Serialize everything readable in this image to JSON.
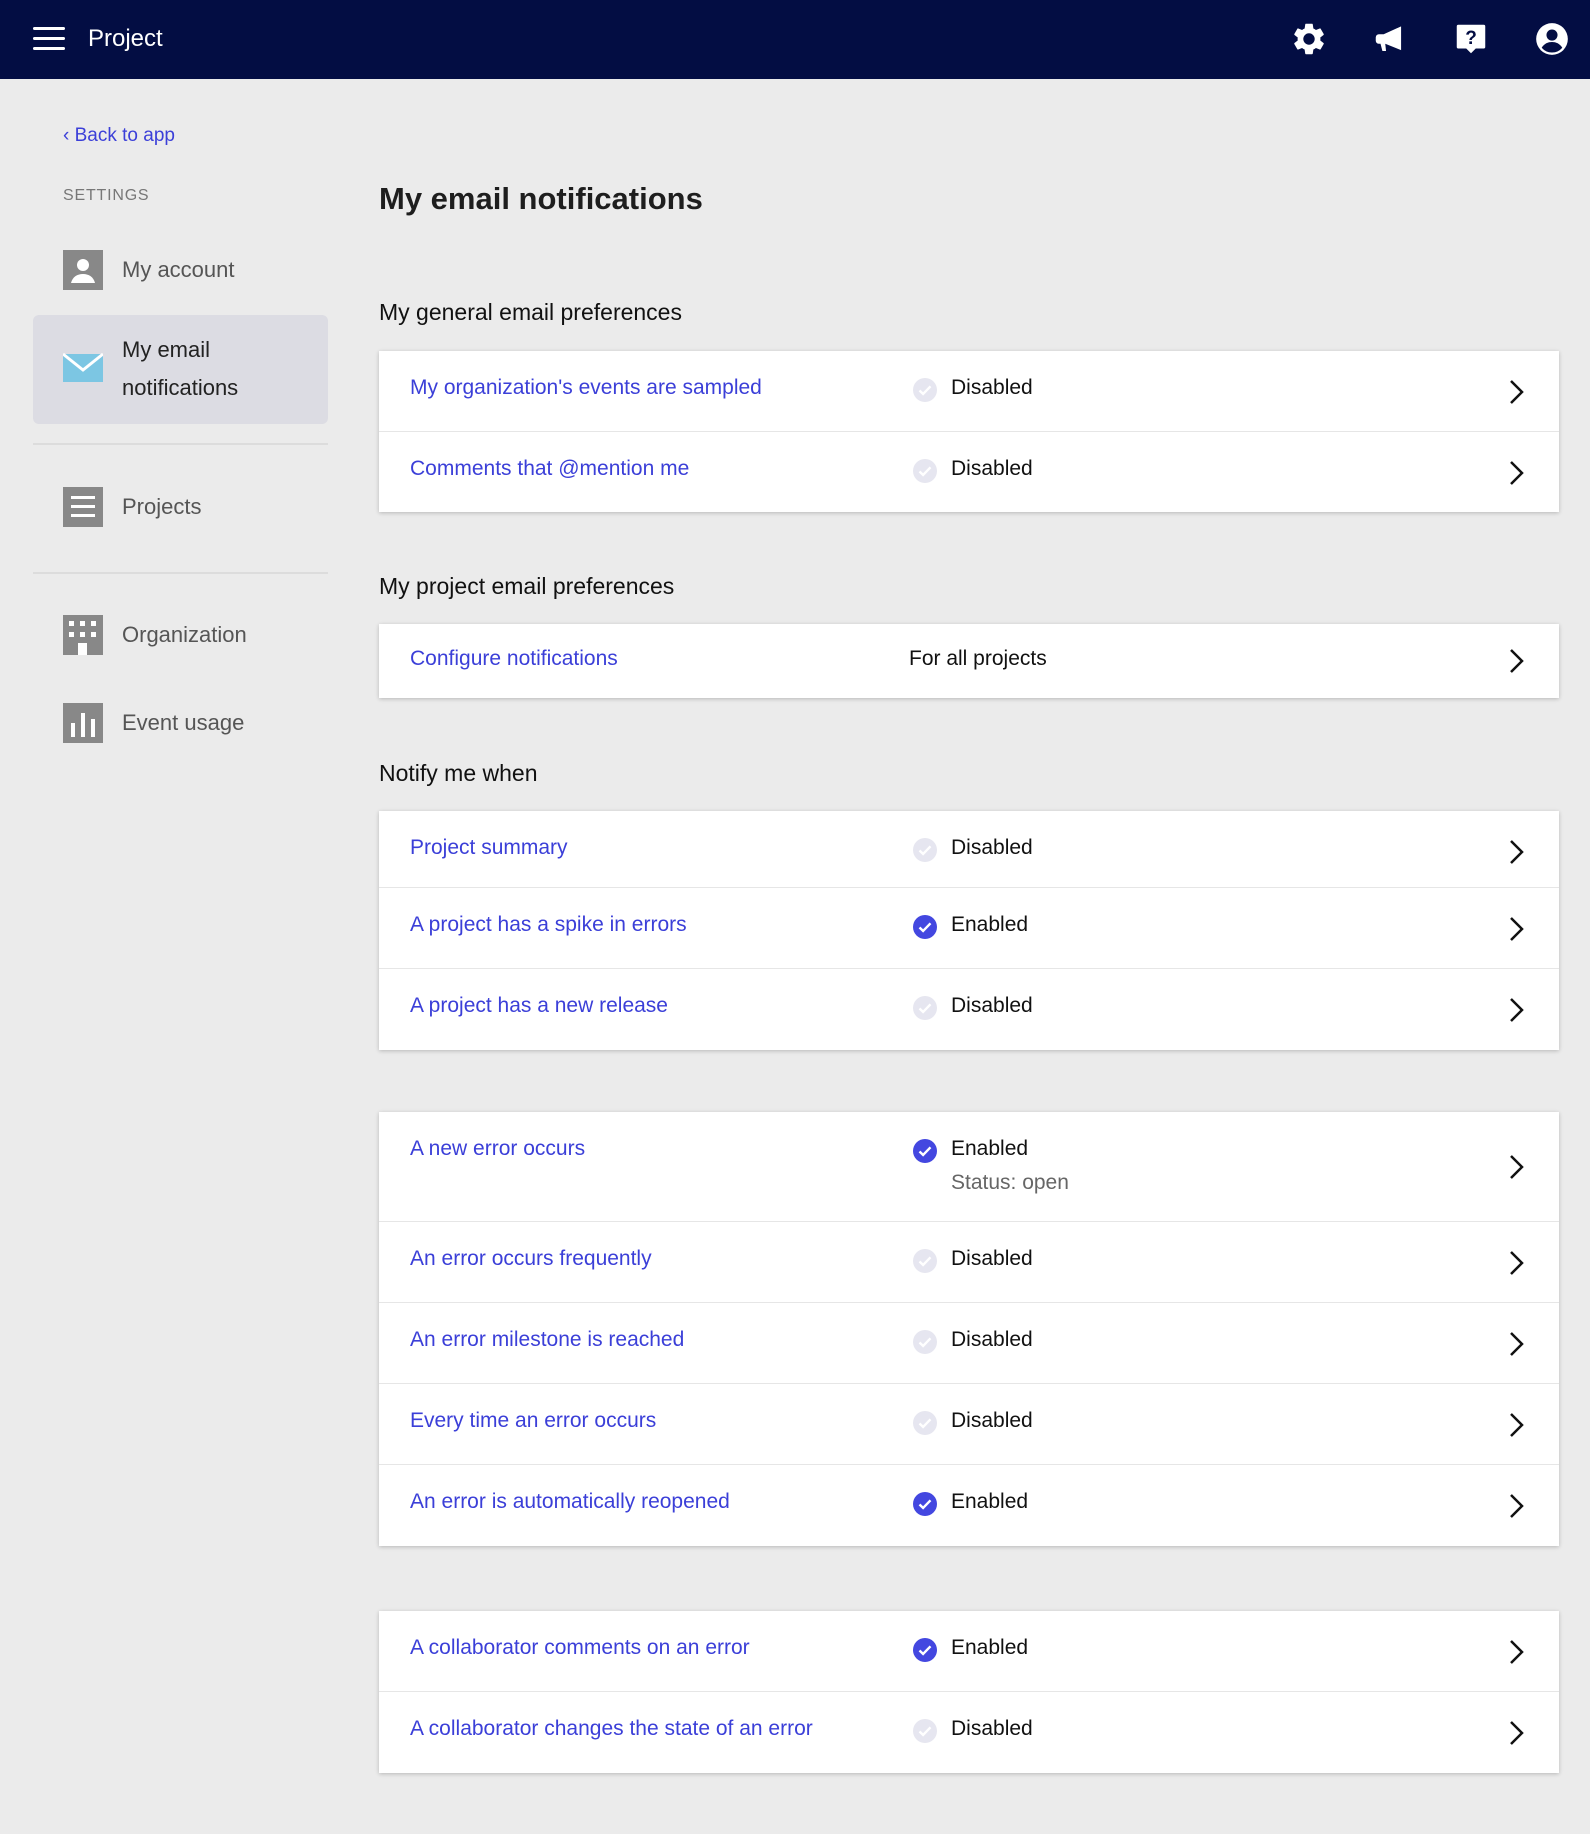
{
  "topbar": {
    "title": "Project",
    "icons": [
      "gear-icon",
      "megaphone-icon",
      "help-icon",
      "user-account-icon"
    ]
  },
  "sidebar": {
    "back_link": "‹ Back to app",
    "section_label": "SETTINGS",
    "items": [
      {
        "label": "My account",
        "icon": "account-icon"
      },
      {
        "label": "My email notifications",
        "icon": "envelope-icon",
        "active": true
      },
      {
        "label": "Projects",
        "icon": "projects-icon"
      },
      {
        "label": "Organization",
        "icon": "building-icon"
      },
      {
        "label": "Event usage",
        "icon": "bar-chart-icon"
      }
    ]
  },
  "main": {
    "title": "My email notifications",
    "general": {
      "heading": "My general email preferences",
      "rows": [
        {
          "label": "My organization's events are sampled",
          "status": "Disabled"
        },
        {
          "label": "Comments that @mention me",
          "status": "Disabled"
        }
      ]
    },
    "project": {
      "heading": "My project email preferences",
      "rows": [
        {
          "label": "Configure notifications",
          "value": "For all projects"
        }
      ]
    },
    "notify": {
      "heading": "Notify me when",
      "summary_rows": [
        {
          "label": "Project summary",
          "status": "Disabled"
        },
        {
          "label": "A project has a spike in errors",
          "status": "Enabled"
        },
        {
          "label": "A project has a new release",
          "status": "Disabled"
        }
      ],
      "error_rows": [
        {
          "label": "A new error occurs",
          "status": "Enabled",
          "sub": "Status: open"
        },
        {
          "label": "An error occurs frequently",
          "status": "Disabled"
        },
        {
          "label": "An error milestone is reached",
          "status": "Disabled"
        },
        {
          "label": "Every time an error occurs",
          "status": "Disabled"
        },
        {
          "label": "An error is automatically reopened",
          "status": "Enabled"
        }
      ],
      "collab_rows": [
        {
          "label": "A collaborator comments on an error",
          "status": "Enabled"
        },
        {
          "label": "A collaborator changes the state of an error",
          "status": "Disabled"
        }
      ]
    }
  },
  "colors": {
    "topbar": "#030d43",
    "link": "#3b3fd8",
    "enabled": "#4347e0",
    "disabled": "#e6e6f0",
    "background": "#ebebeb"
  }
}
